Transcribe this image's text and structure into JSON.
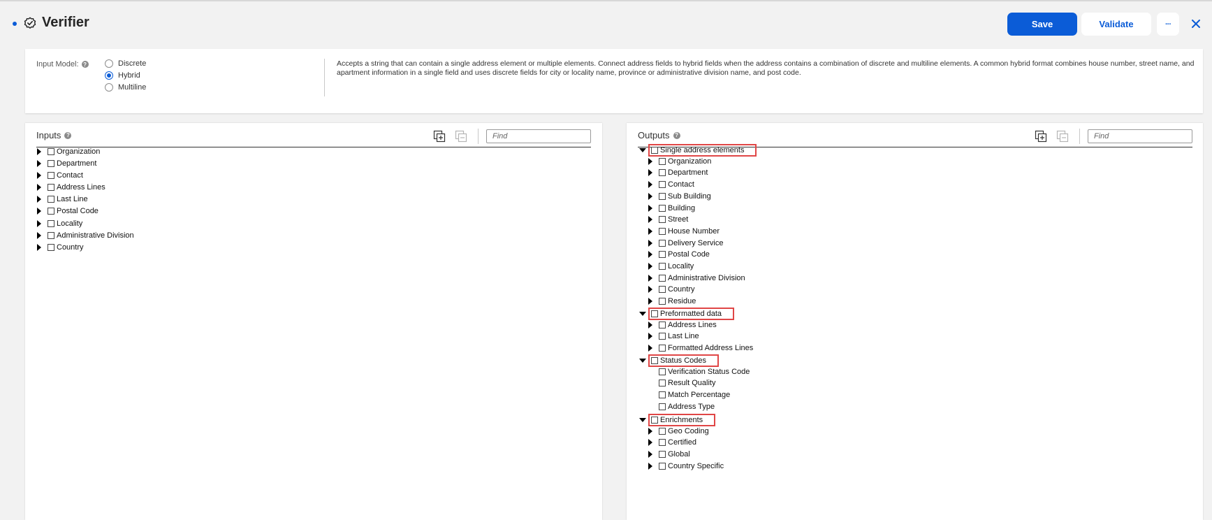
{
  "header": {
    "title": "Verifier",
    "save_label": "Save",
    "validate_label": "Validate",
    "more_label": "···"
  },
  "input_model": {
    "label": "Input Model:",
    "options": [
      "Discrete",
      "Hybrid",
      "Multiline"
    ],
    "selected": "Hybrid",
    "description": "Accepts a string that can contain a single address element or multiple elements. Connect address fields to hybrid fields when the address contains a combination of discrete and multiline elements. A common hybrid format combines house number, street name, and apartment information in a single field and uses discrete fields for city or locality name, province or administrative division name, and post code."
  },
  "inputs": {
    "title": "Inputs",
    "find_placeholder": "Find",
    "items": [
      "Organization",
      "Department",
      "Contact",
      "Address Lines",
      "Last Line",
      "Postal Code",
      "Locality",
      "Administrative Division",
      "Country"
    ]
  },
  "outputs": {
    "title": "Outputs",
    "find_placeholder": "Find",
    "groups": [
      {
        "label": "Single address elements",
        "children": [
          "Organization",
          "Department",
          "Contact",
          "Sub Building",
          "Building",
          "Street",
          "House Number",
          "Delivery Service",
          "Postal Code",
          "Locality",
          "Administrative Division",
          "Country",
          "Residue"
        ]
      },
      {
        "label": "Preformatted data",
        "children": [
          "Address Lines",
          "Last Line",
          "Formatted Address Lines"
        ]
      },
      {
        "label": "Status Codes",
        "children": [
          "Verification Status Code",
          "Result Quality",
          "Match Percentage",
          "Address Type"
        ]
      },
      {
        "label": "Enrichments",
        "children": [
          "Geo Coding",
          "Certified",
          "Global",
          "Country Specific"
        ]
      }
    ]
  },
  "colors": {
    "accent": "#0b5cd7",
    "highlight": "#e04646"
  }
}
